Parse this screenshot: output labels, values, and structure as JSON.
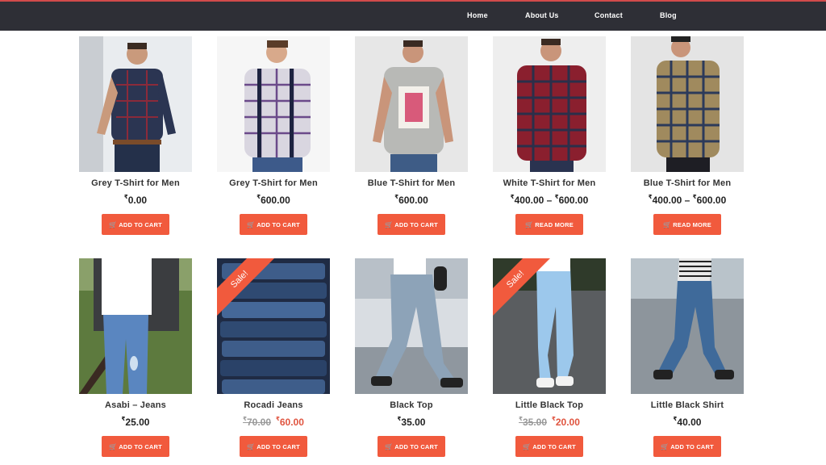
{
  "nav": {
    "items": [
      "Home",
      "About Us",
      "Contact",
      "Blog"
    ]
  },
  "products": [
    {
      "name": "Grey T-Shirt for Men",
      "currency": "₹",
      "price": "0.00",
      "button": "ADD TO CART"
    },
    {
      "name": "Grey T-Shirt for Men",
      "currency": "₹",
      "price": "600.00",
      "button": "ADD TO CART"
    },
    {
      "name": "Blue T-Shirt for Men",
      "currency": "₹",
      "price": "600.00",
      "button": "ADD TO CART"
    },
    {
      "name": "White T-Shirt for Men",
      "currency": "₹",
      "price_min": "400.00",
      "price_max": "600.00",
      "range_sep": "–",
      "button": "READ MORE"
    },
    {
      "name": "Blue T-Shirt for Men",
      "currency": "₹",
      "price_min": "400.00",
      "price_max": "600.00",
      "range_sep": "–",
      "button": "READ MORE"
    },
    {
      "name": "Asabi – Jeans",
      "currency": "₹",
      "price": "25.00",
      "button": "ADD TO CART"
    },
    {
      "name": "Rocadi Jeans",
      "currency": "₹",
      "old_price": "70.00",
      "sale_price": "60.00",
      "badge": "Sale!",
      "button": "ADD TO CART"
    },
    {
      "name": "Black Top",
      "currency": "₹",
      "price": "35.00",
      "button": "ADD TO CART"
    },
    {
      "name": "Little Black Top",
      "currency": "₹",
      "old_price": "35.00",
      "sale_price": "20.00",
      "badge": "Sale!",
      "button": "ADD TO CART"
    },
    {
      "name": "Little Black Shirt",
      "currency": "₹",
      "price": "40.00",
      "button": "ADD TO CART"
    }
  ],
  "colors": {
    "navbar": "#2e2f36",
    "accent": "#f15a3d",
    "sale_price": "#e0543f"
  },
  "icons": {
    "cart": "shopping-cart-icon"
  }
}
